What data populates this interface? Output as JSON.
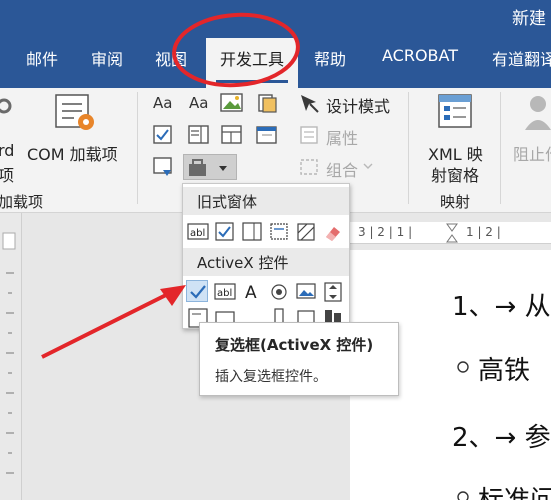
{
  "window": {
    "title": "新建"
  },
  "tabs": [
    {
      "label": "邮件"
    },
    {
      "label": "审阅"
    },
    {
      "label": "视图"
    },
    {
      "label": "开发工具",
      "active": true
    },
    {
      "label": "帮助"
    },
    {
      "label": "ACROBAT"
    },
    {
      "label": "有道翻译"
    }
  ],
  "ribbon": {
    "addins": {
      "word_label_fragment": "rd",
      "word_label_fragment2": "项",
      "com_label": "COM 加载项",
      "group_label": "加载项"
    },
    "controls": {
      "design_mode": "设计模式",
      "properties": "属性",
      "group": "组合"
    },
    "xml": {
      "label_line1": "XML 映",
      "label_line2": "射窗格",
      "group_label": "映射"
    },
    "protect": {
      "label_fragment": "阻止作"
    }
  },
  "popup": {
    "legacy_header": "旧式窗体",
    "activex_header": "ActiveX 控件"
  },
  "tooltip": {
    "title": "复选框(ActiveX 控件)",
    "description": "插入复选框控件。"
  },
  "ruler": {
    "marks": "3 | 2 | 1 |",
    "marks_right": "1 | 2 |"
  },
  "document": {
    "line1": "1、→ 从",
    "line2": "高铁",
    "line3": "2、→ 参",
    "line4": "标准问"
  },
  "colors": {
    "title_bar": "#2b5797",
    "annotation": "#e3262a",
    "ribbon_bg": "#f3f3f3"
  }
}
